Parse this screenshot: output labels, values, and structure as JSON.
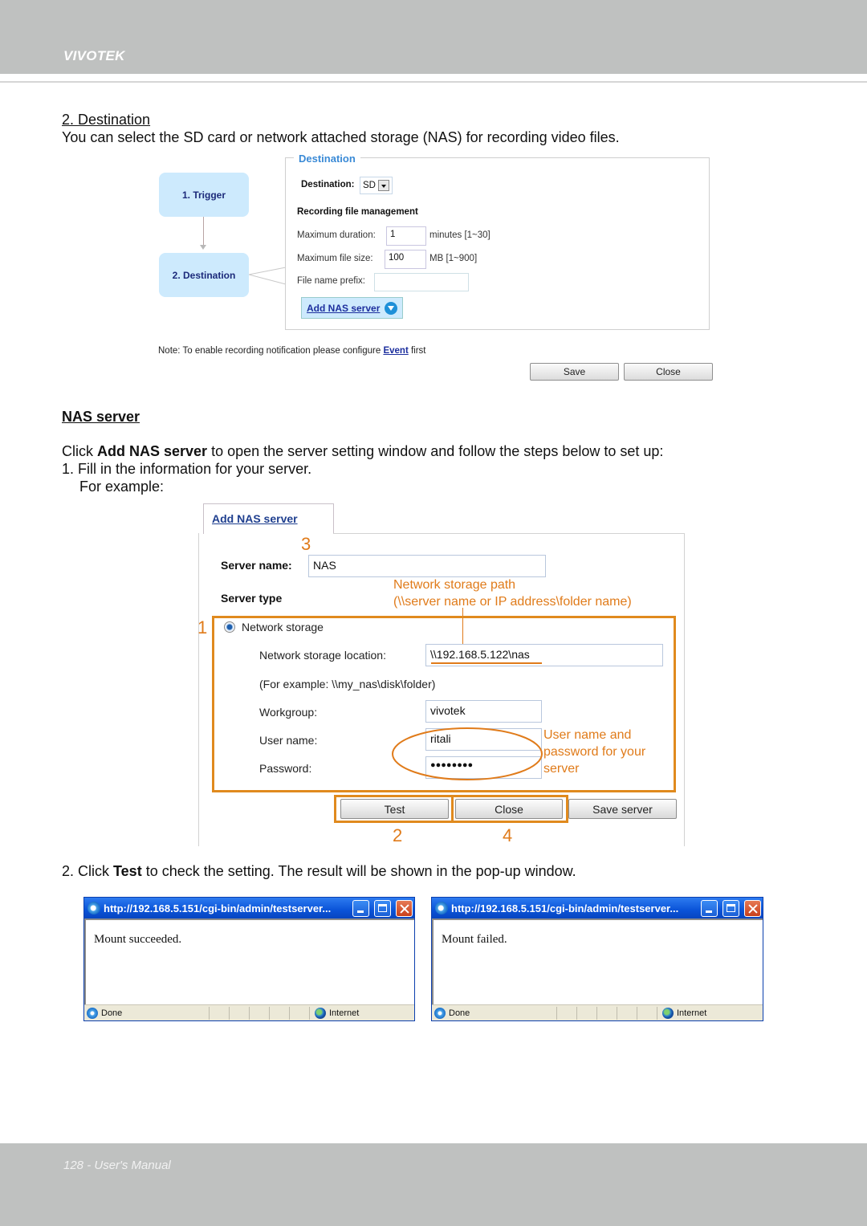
{
  "header": {
    "brand": "VIVOTEK"
  },
  "section_destination": {
    "heading": "2. Destination",
    "description": "You can select the SD card or network attached storage (NAS) for recording video files."
  },
  "destination_screenshot": {
    "steps": [
      {
        "label": "1.  Trigger"
      },
      {
        "label": "2.  Destination"
      }
    ],
    "legend": "Destination",
    "destination_label": "Destination:",
    "destination_value": "SD",
    "recording_heading": "Recording file management",
    "max_duration_label": "Maximum duration:",
    "max_duration_value": "1",
    "max_duration_unit": "minutes [1~30]",
    "max_size_label": "Maximum file size:",
    "max_size_value": "100",
    "max_size_unit": "MB [1~900]",
    "prefix_label": "File name prefix:",
    "prefix_value": "",
    "add_nas_label": "Add NAS server",
    "note_prefix": "Note: To enable recording notification please configure ",
    "note_link": "Event",
    "note_suffix": " first",
    "save_label": "Save",
    "close_label": "Close"
  },
  "section_nas": {
    "heading": "NAS server",
    "intro_prefix": "Click ",
    "intro_bold": "Add NAS server",
    "intro_suffix": " to open the server setting window and follow the steps below to set up:",
    "step1": "1. Fill in the information for your server.",
    "step1_example": "For example:"
  },
  "nas_screenshot": {
    "tab_label": "Add NAS server",
    "server_name_label": "Server name:",
    "server_name_value": "NAS",
    "server_type_label": "Server type",
    "radio_label": "Network storage",
    "location_label": "Network storage location:",
    "location_value": "\\\\192.168.5.122\\nas",
    "example_text": "(For example: \\\\my_nas\\disk\\folder)",
    "workgroup_label": "Workgroup:",
    "workgroup_value": "vivotek",
    "username_label": "User name:",
    "username_value": "ritali",
    "password_label": "Password:",
    "password_value": "●●●●●●●●",
    "test_label": "Test",
    "close_label": "Close",
    "save_server_label": "Save server",
    "annotations": {
      "path_line1": "Network storage path",
      "path_line2": "(\\\\server name or IP address\\folder name)",
      "cred_line1": "User name and",
      "cred_line2": "password for your",
      "cred_line3": "server",
      "num1": "1",
      "num2": "2",
      "num3": "3",
      "num4": "4"
    }
  },
  "section_test": {
    "prefix": "2. Click ",
    "bold": "Test",
    "suffix": " to check the setting. The result will be shown in the pop-up window."
  },
  "popups": [
    {
      "title": "http://192.168.5.151/cgi-bin/admin/testserver...",
      "message": "Mount succeeded.",
      "status_left": "Done",
      "status_zone": "Internet"
    },
    {
      "title": "http://192.168.5.151/cgi-bin/admin/testserver...",
      "message": "Mount failed.",
      "status_left": "Done",
      "status_zone": "Internet"
    }
  ],
  "footer": {
    "text": "128 - User's Manual"
  },
  "colors": {
    "annotation": "#e07b1a",
    "band": "#bfc1c0",
    "link": "#1d2f9e",
    "legend": "#3a8ad6"
  }
}
